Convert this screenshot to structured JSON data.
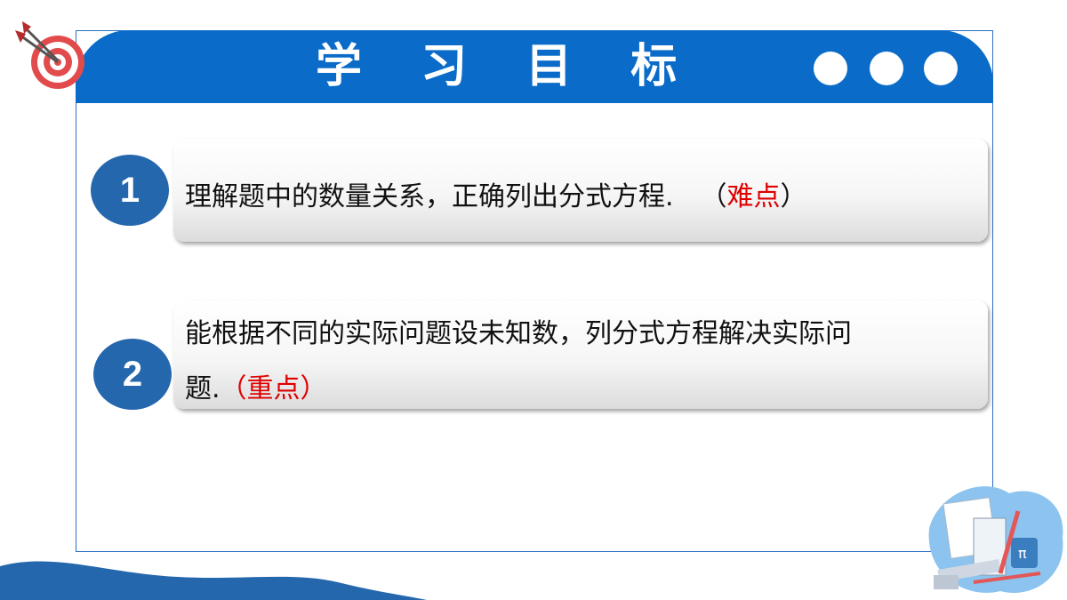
{
  "header": {
    "title": "学 习 目 标"
  },
  "goals": [
    {
      "number": "1",
      "text": "理解题中的数量关系，正确列出分式方程.",
      "paren_open": "（",
      "tag": "难点",
      "paren_close": "）"
    },
    {
      "number": "2",
      "line1": "能根据不同的实际问题设未知数，列分式方程解决实际问",
      "line2": "题.",
      "paren_open": "（",
      "tag": "重点",
      "paren_close": "）"
    }
  ],
  "colors": {
    "header": "#0a6cc8",
    "circle": "#2467ad",
    "emphasis": "#e00000"
  },
  "icons": [
    "target-dart-icon",
    "math-tools-icon"
  ]
}
